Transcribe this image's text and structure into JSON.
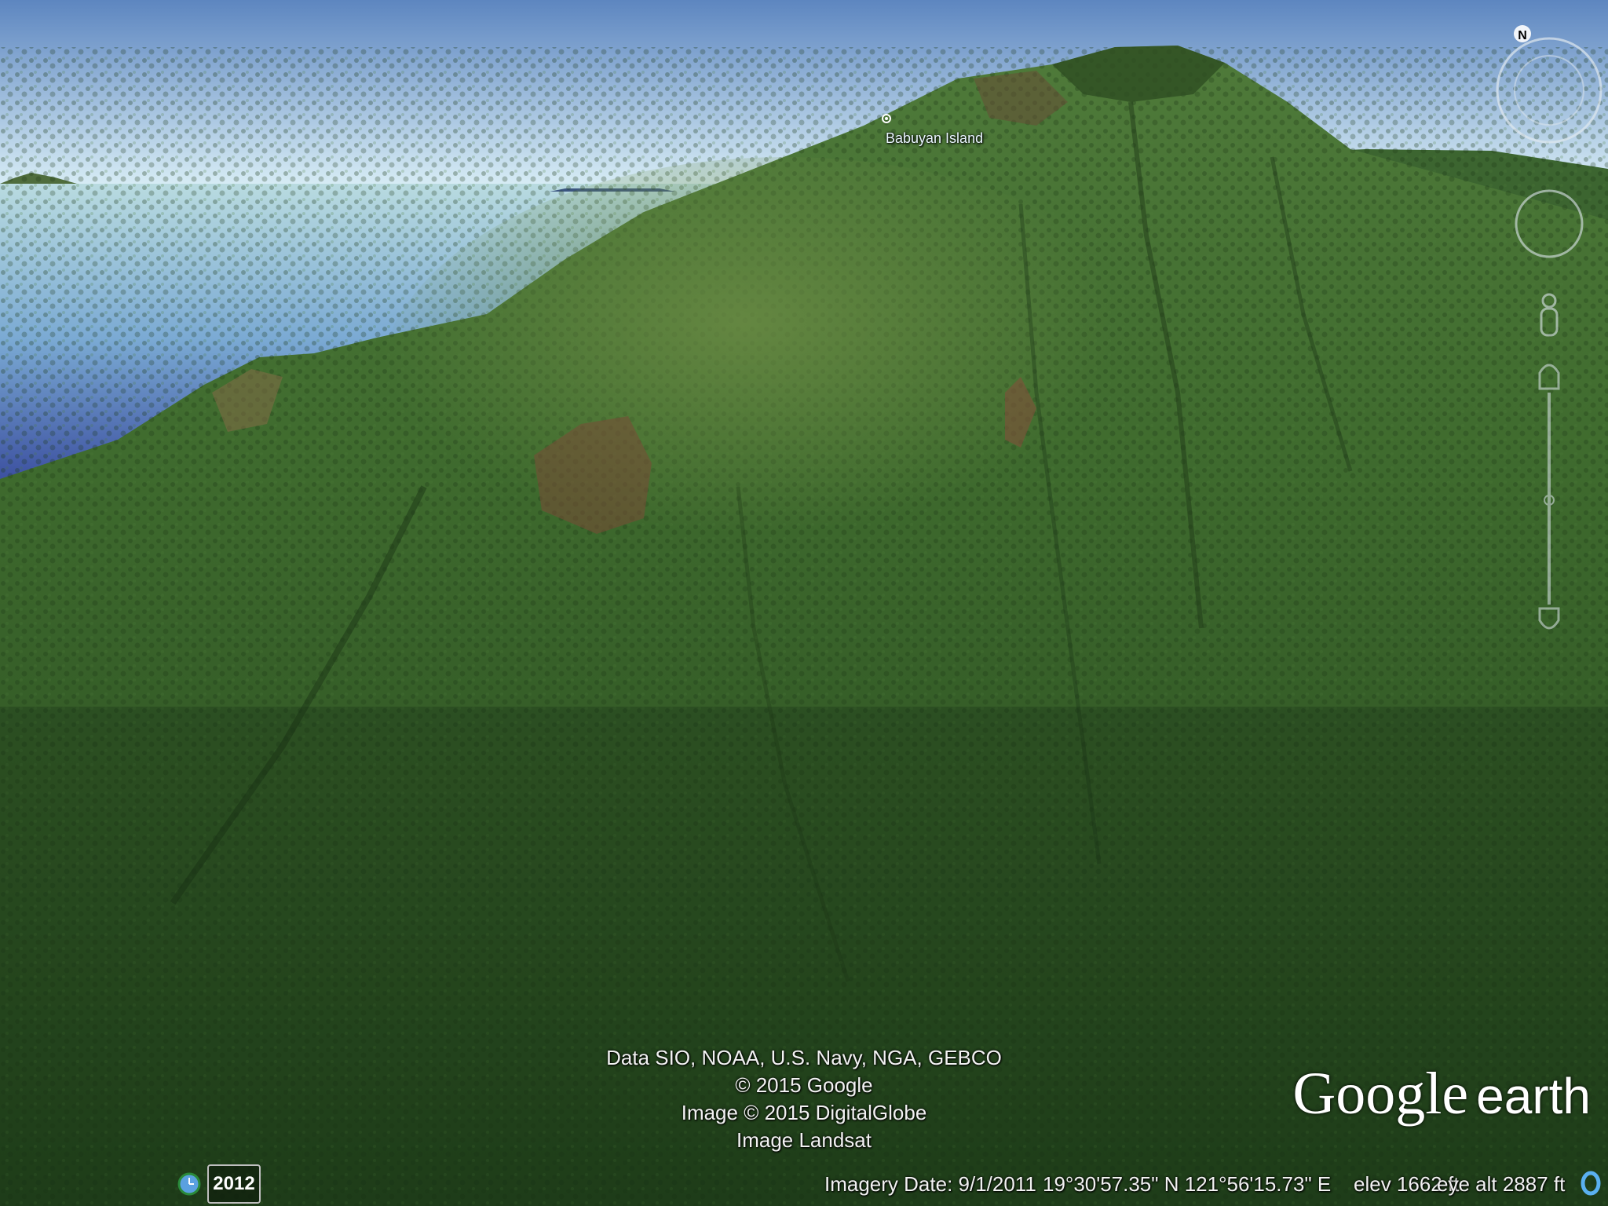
{
  "map": {
    "place_label": "Babuyan Island"
  },
  "attribution": [
    "Data SIO, NOAA, U.S. Navy, NGA, GEBCO",
    "© 2015 Google",
    "Image © 2015 DigitalGlobe",
    "Image Landsat"
  ],
  "timeline": {
    "year": "2012"
  },
  "status_bar": {
    "imagery_date": "Imagery Date: 9/1/2011",
    "coordinates": "19°30'57.35\" N  121°56'15.73\" E",
    "elevation": "elev  1662 ft",
    "eye_altitude": "eye alt  2887 ft"
  },
  "logo": {
    "brand": "Google",
    "product": "earth"
  },
  "compass": {
    "north_label": "N"
  },
  "colors": {
    "sky_top": "#5d86c0",
    "sky_horizon": "#d9eef6",
    "sea": "#6c9ccd",
    "forest": "#2f5a24"
  }
}
